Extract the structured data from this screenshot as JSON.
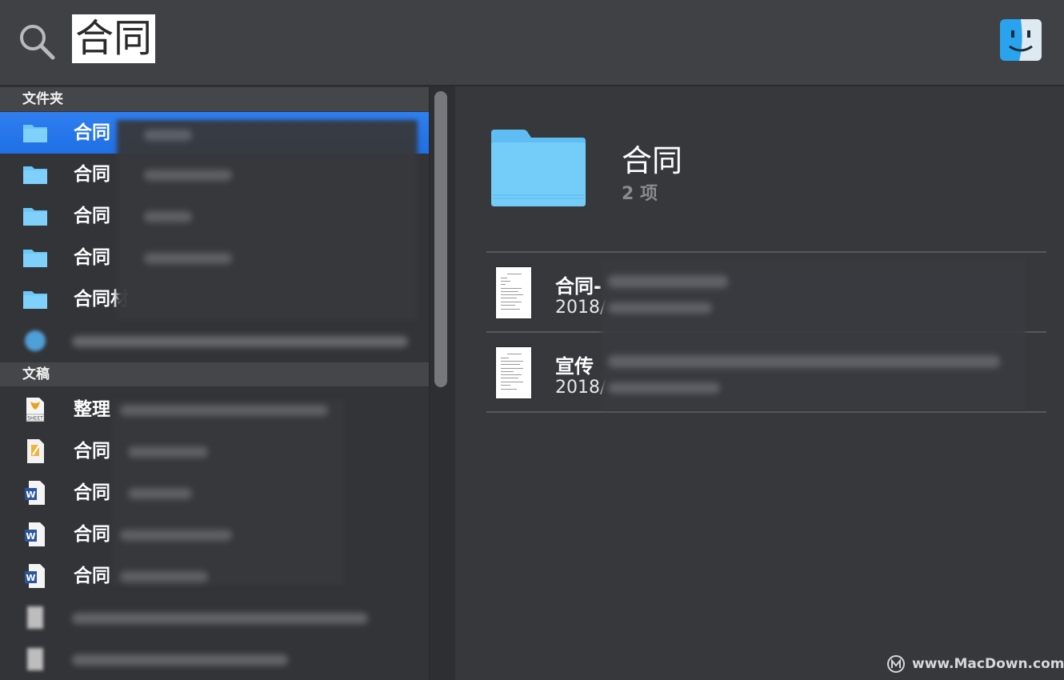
{
  "search": {
    "query": "合同"
  },
  "results": {
    "sections": [
      {
        "title": "文件夹",
        "items": [
          {
            "label": "合同",
            "icon": "folder-icon",
            "selected": true
          },
          {
            "label": "合同",
            "icon": "folder-icon",
            "selected": false
          },
          {
            "label": "合同",
            "icon": "folder-icon",
            "selected": false
          },
          {
            "label": "合同",
            "icon": "folder-icon",
            "selected": false
          },
          {
            "label": "合同材",
            "icon": "folder-icon",
            "selected": false
          },
          {
            "label": "",
            "icon": "app-icon",
            "selected": false
          }
        ]
      },
      {
        "title": "文稿",
        "items": [
          {
            "label": "整理",
            "icon": "sheet-document-icon"
          },
          {
            "label": "合同",
            "icon": "pages-document-icon"
          },
          {
            "label": "合同",
            "icon": "word-document-icon"
          },
          {
            "label": "合同",
            "icon": "word-document-icon"
          },
          {
            "label": "合同",
            "icon": "word-document-icon"
          },
          {
            "label": "",
            "icon": "document-icon"
          },
          {
            "label": "",
            "icon": "document-icon"
          }
        ]
      }
    ]
  },
  "preview": {
    "title": "合同",
    "subtitle": "2 项",
    "files": [
      {
        "name": "合同-",
        "date": "2018/",
        "icon": "document-thumbnail-icon"
      },
      {
        "name": "宣传",
        "date": "2018/",
        "icon": "document-thumbnail-icon"
      }
    ]
  },
  "watermark": {
    "text": "www.MacDown.com"
  },
  "colors": {
    "selection": "#2f7ff0",
    "folder": "#6cc6f7",
    "background": "#35363a"
  }
}
